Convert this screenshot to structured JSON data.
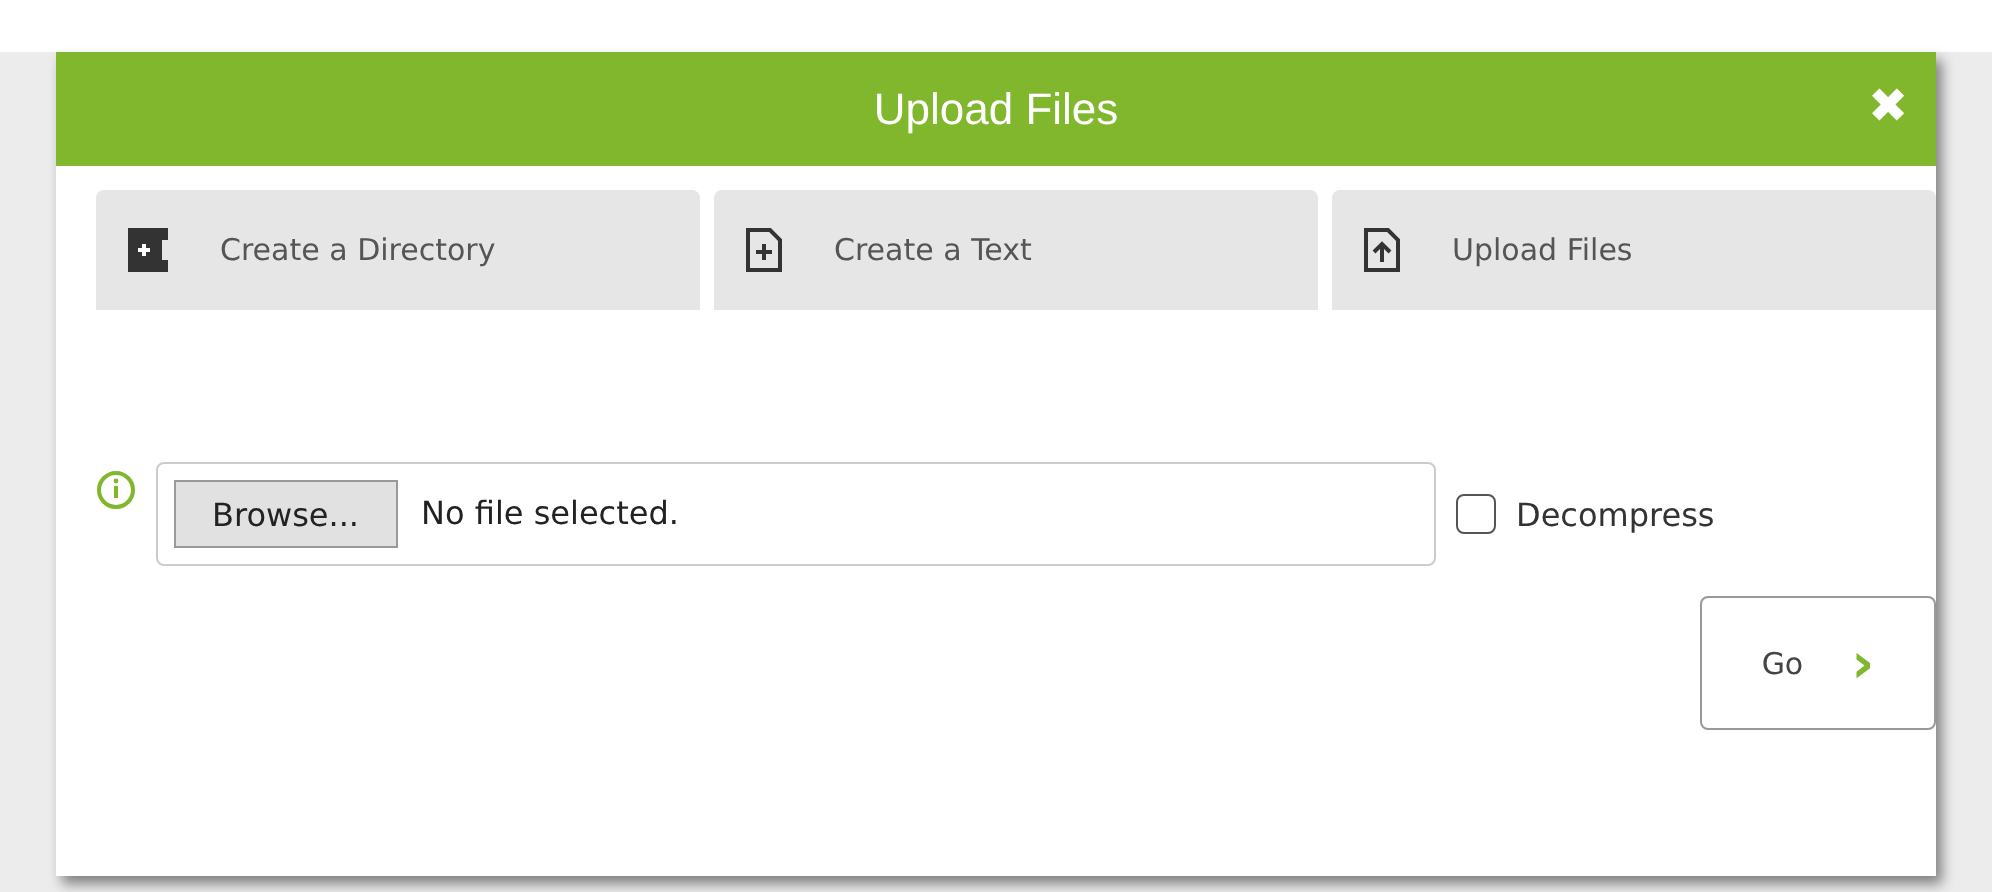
{
  "dialog": {
    "title": "Upload Files",
    "close": "✖"
  },
  "tabs": [
    {
      "label": "Create a Directory",
      "kind": "directory",
      "selected": false
    },
    {
      "label": "Create a Text",
      "kind": "text",
      "selected": false
    },
    {
      "label": "Upload Files",
      "kind": "upload",
      "selected": false
    }
  ],
  "file_input": {
    "button": "Browse...",
    "value": "No file selected."
  },
  "decompress": {
    "label": "Decompress",
    "checked": false
  },
  "go_button": {
    "label": "Go",
    "caret": "›"
  }
}
